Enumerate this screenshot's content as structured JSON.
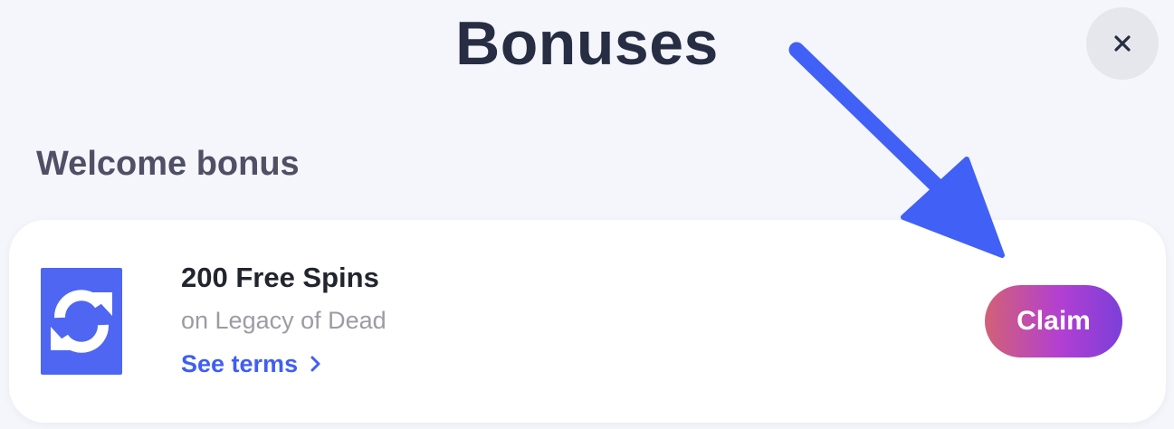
{
  "header": {
    "title": "Bonuses",
    "close_icon": "close-icon"
  },
  "section": {
    "title": "Welcome bonus"
  },
  "bonus": {
    "title": "200 Free Spins",
    "subtitle": "on Legacy of Dead",
    "terms_label": "See terms",
    "claim_label": "Claim",
    "logo_icon": "refresh-arrows-icon",
    "terms_icon": "chevron-right-icon"
  },
  "colors": {
    "background": "#f5f6fb",
    "accent_blue": "#4e66f2",
    "link_blue": "#3f5ef5",
    "claim_gradient_start": "#d26176",
    "claim_gradient_end": "#7c3fd9"
  }
}
